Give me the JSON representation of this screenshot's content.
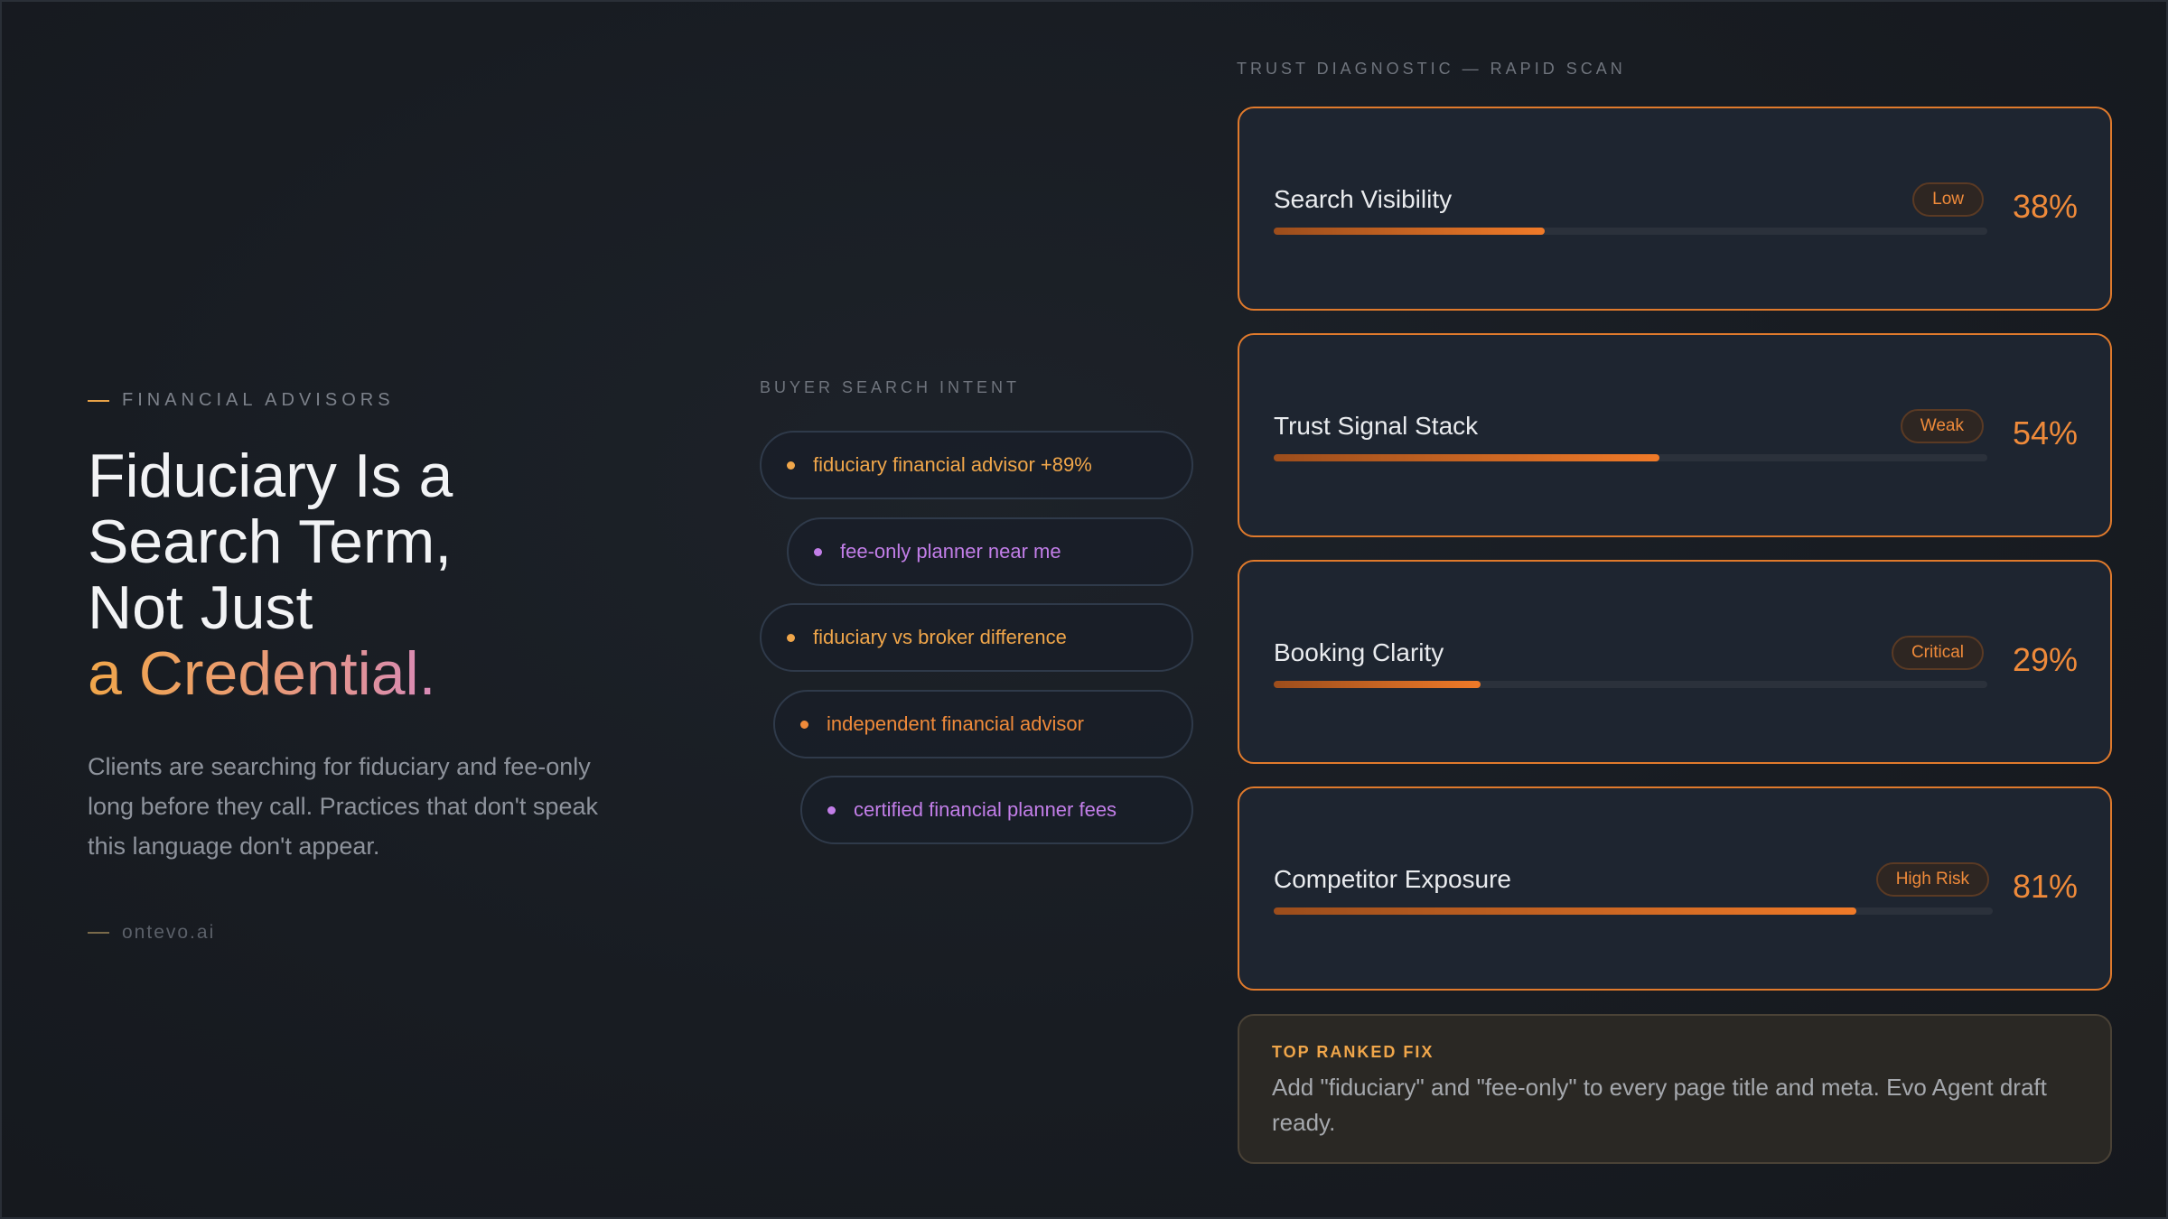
{
  "hero": {
    "eyebrow": "Financial Advisors",
    "headline_line1": "Fiduciary Is a",
    "headline_line2": "Search Term,",
    "headline_line3": "Not Just",
    "headline_accent": "a Credential.",
    "lead": "Clients are searching for fiduciary and fee-only long before they call. Practices that don't speak this language don't appear.",
    "signature": "ontevo.ai"
  },
  "intent": {
    "label": "Buyer Search Intent",
    "terms": [
      {
        "text": "fiduciary financial advisor +89%",
        "tone": "orange"
      },
      {
        "text": "fee-only planner near me",
        "tone": "purple"
      },
      {
        "text": "fiduciary vs broker difference",
        "tone": "orange"
      },
      {
        "text": "independent financial advisor",
        "tone": "amber"
      },
      {
        "text": "certified financial planner fees",
        "tone": "purple"
      }
    ]
  },
  "diagnostic": {
    "label": "Trust Diagnostic — Rapid Scan",
    "metrics": [
      {
        "name": "Search Visibility",
        "badge": "Low",
        "percent_label": "38%",
        "value": 38
      },
      {
        "name": "Trust Signal Stack",
        "badge": "Weak",
        "percent_label": "54%",
        "value": 54
      },
      {
        "name": "Booking Clarity",
        "badge": "Critical",
        "percent_label": "29%",
        "value": 29
      },
      {
        "name": "Competitor Exposure",
        "badge": "High Risk",
        "percent_label": "81%",
        "value": 81
      }
    ]
  },
  "top_fix": {
    "label": "Top Ranked Fix",
    "text": "Add \"fiduciary\" and \"fee-only\" to every page title and meta. Evo Agent draft ready."
  },
  "colors": {
    "accent_orange": "#ef8a3a",
    "accent_gold": "#f0a64a",
    "accent_purple": "#c27ee8",
    "card_border": "#e07a2c"
  }
}
